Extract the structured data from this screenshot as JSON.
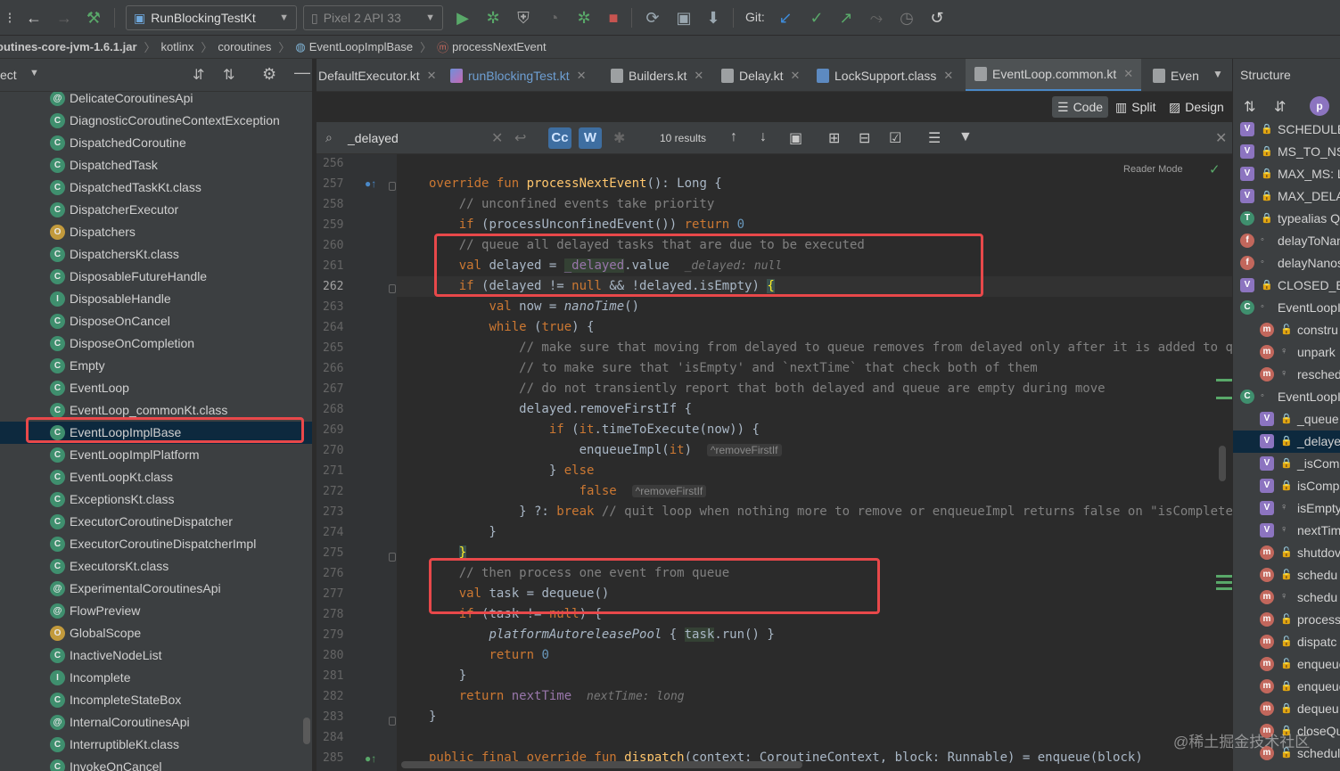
{
  "toolbar": {
    "run_config": "RunBlockingTestKt",
    "device": "Pixel 2 API 33",
    "git_label": "Git:"
  },
  "breadcrumb": [
    "outines-core-jvm-1.6.1.jar",
    "kotlinx",
    "coroutines",
    "EventLoopImplBase",
    "processNextEvent"
  ],
  "project": {
    "header_label": "ect",
    "items": [
      {
        "label": "DelicateCoroutinesApi",
        "icon": "annotation-icon"
      },
      {
        "label": "DiagnosticCoroutineContextException",
        "icon": "class-icon"
      },
      {
        "label": "DispatchedCoroutine",
        "icon": "class-icon"
      },
      {
        "label": "DispatchedTask",
        "icon": "class-icon"
      },
      {
        "label": "DispatchedTaskKt.class",
        "icon": "class-file-icon"
      },
      {
        "label": "DispatcherExecutor",
        "icon": "class-icon"
      },
      {
        "label": "Dispatchers",
        "icon": "object-icon"
      },
      {
        "label": "DispatchersKt.class",
        "icon": "class-file-icon"
      },
      {
        "label": "DisposableFutureHandle",
        "icon": "class-icon"
      },
      {
        "label": "DisposableHandle",
        "icon": "interface-icon"
      },
      {
        "label": "DisposeOnCancel",
        "icon": "class-icon"
      },
      {
        "label": "DisposeOnCompletion",
        "icon": "class-icon"
      },
      {
        "label": "Empty",
        "icon": "class-icon"
      },
      {
        "label": "EventLoop",
        "icon": "class-icon"
      },
      {
        "label": "EventLoop_commonKt.class",
        "icon": "class-file-icon"
      },
      {
        "label": "EventLoopImplBase",
        "icon": "class-icon"
      },
      {
        "label": "EventLoopImplPlatform",
        "icon": "class-icon"
      },
      {
        "label": "EventLoopKt.class",
        "icon": "class-file-icon"
      },
      {
        "label": "ExceptionsKt.class",
        "icon": "class-file-icon"
      },
      {
        "label": "ExecutorCoroutineDispatcher",
        "icon": "class-icon"
      },
      {
        "label": "ExecutorCoroutineDispatcherImpl",
        "icon": "class-icon"
      },
      {
        "label": "ExecutorsKt.class",
        "icon": "class-file-icon"
      },
      {
        "label": "ExperimentalCoroutinesApi",
        "icon": "annotation-icon"
      },
      {
        "label": "FlowPreview",
        "icon": "annotation-icon"
      },
      {
        "label": "GlobalScope",
        "icon": "object-icon"
      },
      {
        "label": "InactiveNodeList",
        "icon": "class-icon"
      },
      {
        "label": "Incomplete",
        "icon": "interface-icon"
      },
      {
        "label": "IncompleteStateBox",
        "icon": "class-icon"
      },
      {
        "label": "InternalCoroutinesApi",
        "icon": "annotation-icon"
      },
      {
        "label": "InterruptibleKt.class",
        "icon": "class-file-icon"
      },
      {
        "label": "InvokeOnCancel",
        "icon": "class-icon"
      }
    ]
  },
  "tabs": [
    {
      "label": "DefaultExecutor.kt"
    },
    {
      "label": "runBlockingTest.kt"
    },
    {
      "label": "Builders.kt"
    },
    {
      "label": "Delay.kt"
    },
    {
      "label": "LockSupport.class"
    },
    {
      "label": "EventLoop.common.kt"
    },
    {
      "label": "Even"
    }
  ],
  "view_modes": {
    "code": "Code",
    "split": "Split",
    "design": "Design"
  },
  "search": {
    "query": "_delayed",
    "results": "10 results",
    "case_btn": "Cc",
    "word_btn": "W"
  },
  "editor": {
    "reader_mode": "Reader Mode",
    "line_numbers": [
      "256",
      "257",
      "258",
      "259",
      "260",
      "261",
      "262",
      "263",
      "264",
      "265",
      "266",
      "267",
      "268",
      "269",
      "270",
      "271",
      "272",
      "273",
      "274",
      "275",
      "276",
      "277",
      "278",
      "279",
      "280",
      "281",
      "282",
      "283",
      "284",
      "285"
    ],
    "current_line": "262",
    "hints": {
      "delayed_hint": "_delayed: null",
      "remove_first_if_1": "^removeFirstIf",
      "remove_first_if_2": "^removeFirstIf",
      "next_time_hint": "nextTime: long"
    }
  },
  "structure": {
    "title": "Structure",
    "items": [
      {
        "name": "SCHEDULE",
        "kind": "v"
      },
      {
        "name": "MS_TO_NS",
        "kind": "v"
      },
      {
        "name": "MAX_MS: L",
        "kind": "v"
      },
      {
        "name": "MAX_DELA",
        "kind": "v"
      },
      {
        "name": "typealias Q",
        "kind": "c"
      },
      {
        "name": "delayToNan",
        "kind": "f"
      },
      {
        "name": "delayNanos",
        "kind": "f"
      },
      {
        "name": "CLOSED_E",
        "kind": "v"
      },
      {
        "name": "EventLoopI",
        "kind": "c"
      },
      {
        "name": "constru",
        "kind": "m"
      },
      {
        "name": "unpark",
        "kind": "m"
      },
      {
        "name": "resched",
        "kind": "m"
      },
      {
        "name": "EventLoopI",
        "kind": "c"
      },
      {
        "name": "_queue",
        "kind": "v"
      },
      {
        "name": "_delaye",
        "kind": "v"
      },
      {
        "name": "_isCom",
        "kind": "v"
      },
      {
        "name": "isComp",
        "kind": "v"
      },
      {
        "name": "isEmpty",
        "kind": "v"
      },
      {
        "name": "nextTim",
        "kind": "v"
      },
      {
        "name": "shutdov",
        "kind": "m"
      },
      {
        "name": "schedu",
        "kind": "m"
      },
      {
        "name": "schedu",
        "kind": "m"
      },
      {
        "name": "process",
        "kind": "m"
      },
      {
        "name": "dispatc",
        "kind": "m"
      },
      {
        "name": "enqueue",
        "kind": "m"
      },
      {
        "name": "enqueue",
        "kind": "m"
      },
      {
        "name": "dequeu",
        "kind": "m"
      },
      {
        "name": "closeQu",
        "kind": "m"
      },
      {
        "name": "schedul",
        "kind": "m"
      }
    ]
  },
  "watermark": "@稀土掘金技术社区",
  "colors": {
    "selection": "#0d293e",
    "annotation_box": "#e8484a",
    "accent": "#4a88c7"
  }
}
